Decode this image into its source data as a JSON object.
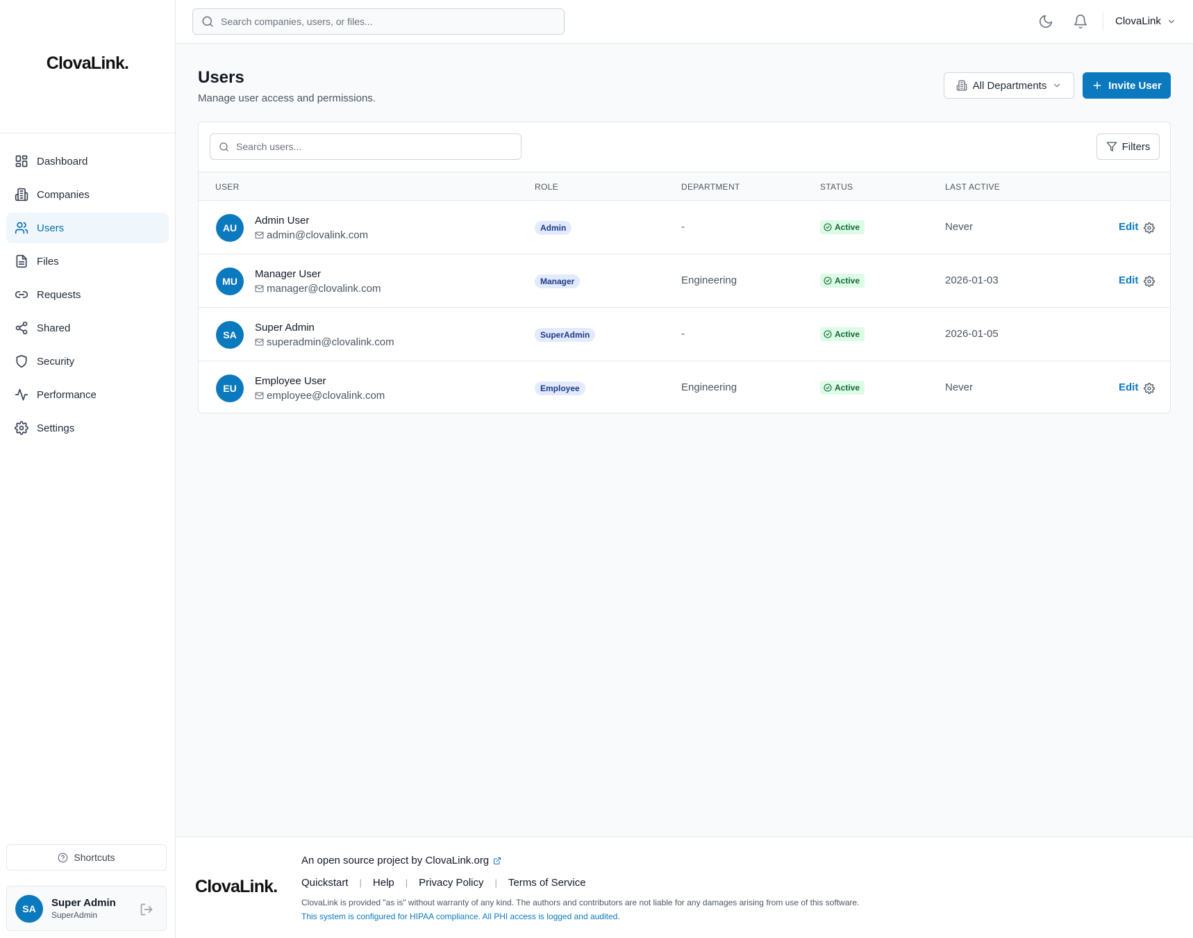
{
  "app": {
    "logo": "ClovaLink."
  },
  "sidebar": {
    "items": [
      {
        "label": "Dashboard",
        "icon": "dashboard-icon",
        "active": false
      },
      {
        "label": "Companies",
        "icon": "building-icon",
        "active": false
      },
      {
        "label": "Users",
        "icon": "users-icon",
        "active": true
      },
      {
        "label": "Files",
        "icon": "file-icon",
        "active": false
      },
      {
        "label": "Requests",
        "icon": "link-icon",
        "active": false
      },
      {
        "label": "Shared",
        "icon": "share-icon",
        "active": false
      },
      {
        "label": "Security",
        "icon": "shield-icon",
        "active": false
      },
      {
        "label": "Performance",
        "icon": "activity-icon",
        "active": false
      },
      {
        "label": "Settings",
        "icon": "gear-icon",
        "active": false
      }
    ],
    "shortcuts_label": "Shortcuts",
    "current_user": {
      "initials": "SA",
      "name": "Super Admin",
      "role": "SuperAdmin"
    }
  },
  "header": {
    "search_placeholder": "Search companies, users, or files...",
    "org_name": "ClovaLink"
  },
  "page": {
    "title": "Users",
    "subtitle": "Manage user access and permissions.",
    "department_filter": "All Departments",
    "invite_label": "Invite User",
    "table_search_placeholder": "Search users...",
    "filters_label": "Filters",
    "columns": {
      "user": "USER",
      "role": "ROLE",
      "department": "DEPARTMENT",
      "status": "STATUS",
      "last_active": "LAST ACTIVE"
    },
    "users": [
      {
        "initials": "AU",
        "name": "Admin User",
        "email": "admin@clovalink.com",
        "role": "Admin",
        "department": "-",
        "status": "Active",
        "last_active": "Never",
        "edit": "Edit",
        "editable": true
      },
      {
        "initials": "MU",
        "name": "Manager User",
        "email": "manager@clovalink.com",
        "role": "Manager",
        "department": "Engineering",
        "status": "Active",
        "last_active": "2026-01-03",
        "edit": "Edit",
        "editable": true
      },
      {
        "initials": "SA",
        "name": "Super Admin",
        "email": "superadmin@clovalink.com",
        "role": "SuperAdmin",
        "department": "-",
        "status": "Active",
        "last_active": "2026-01-05",
        "edit": "",
        "editable": false
      },
      {
        "initials": "EU",
        "name": "Employee User",
        "email": "employee@clovalink.com",
        "role": "Employee",
        "department": "Engineering",
        "status": "Active",
        "last_active": "Never",
        "edit": "Edit",
        "editable": true
      }
    ]
  },
  "footer": {
    "logo": "ClovaLink.",
    "tagline": "An open source project by ClovaLink.org",
    "links": [
      "Quickstart",
      "Help",
      "Privacy Policy",
      "Terms of Service"
    ],
    "disclaimer": "ClovaLink is provided \"as is\" without warranty of any kind. The authors and contributors are not liable for any damages arising from use of this software.",
    "hipaa": "This system is configured for HIPAA compliance. All PHI access is logged and audited."
  },
  "colors": {
    "accent": "#0b79be",
    "active_bg": "#eff6fc",
    "status_bg": "#dcfce7",
    "status_text": "#166534",
    "role_bg": "#e2eafc"
  }
}
